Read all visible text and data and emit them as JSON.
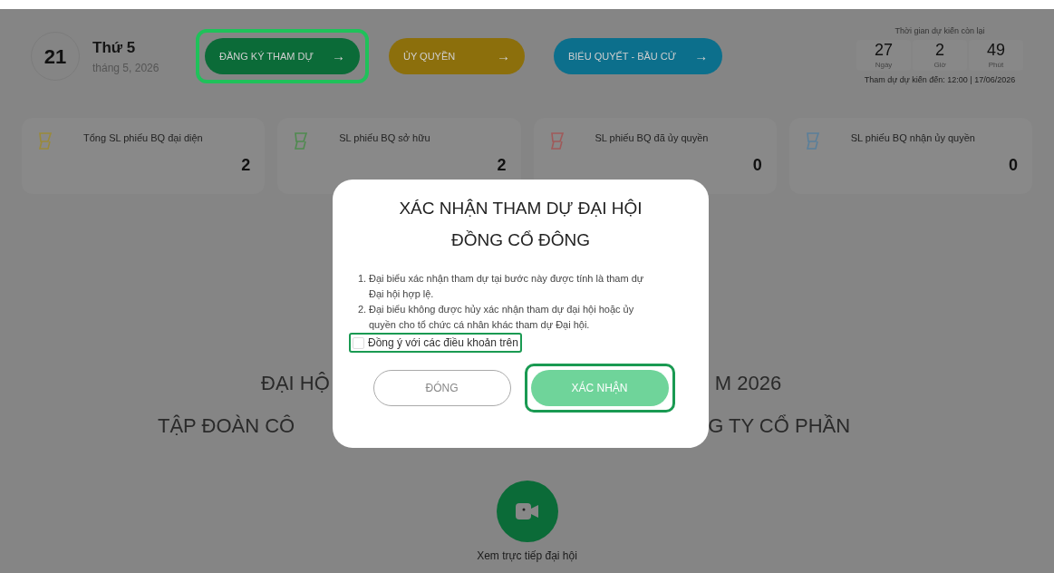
{
  "date": {
    "day": "21",
    "weekday": "Thứ 5",
    "month": "tháng 5, 2026"
  },
  "actions": [
    {
      "label": "ĐĂNG KÝ THAM DỰ",
      "arrow": "→",
      "color": "#0b6b38",
      "highlighted": true
    },
    {
      "label": "ỦY QUYỀN",
      "arrow": "→",
      "color": "#8c6f0c",
      "highlighted": false
    },
    {
      "label": "BIỂU QUYẾT - BẦU CỬ",
      "arrow": "→",
      "color": "#0c6f8c",
      "highlighted": false
    }
  ],
  "countdown": {
    "title": "Thời gian dự kiến còn lại",
    "units": [
      {
        "value": "27",
        "unit": "Ngày"
      },
      {
        "value": "2",
        "unit": "Giờ"
      },
      {
        "value": "49",
        "unit": "Phút"
      }
    ],
    "note": "Tham dự dự kiến đến: 12:00 | 17/06/2026"
  },
  "stats": [
    {
      "label": "Tổng SL phiếu BQ đại diện",
      "value": "2",
      "color": "#9a8a3a"
    },
    {
      "label": "SL phiếu BQ sở hữu",
      "value": "2",
      "color": "#4f8a4f"
    },
    {
      "label": "SL phiếu BQ đã ủy quyền",
      "value": "0",
      "color": "#a05a5a"
    },
    {
      "label": "SL phiếu BQ nhận ủy quyền",
      "value": "0",
      "color": "#5a7f9a"
    }
  ],
  "headline": {
    "line_1_left": "ĐẠI HỘ",
    "line_1_right": "M 2026",
    "line_2_left": "TẬP ĐOÀN CÔ",
    "line_2_right": "G TY CỔ PHẦN"
  },
  "live": {
    "label": "Xem trực tiếp đại hội"
  },
  "dialog": {
    "title_1": "XÁC NHẬN THAM DỰ ĐẠI HỘI",
    "title_2": "ĐỒNG CỔ ĐÔNG",
    "terms": [
      {
        "number": "1.",
        "text": "Đại biểu xác nhận tham dự tại bước này được tính là tham dự Đại hội hợp lệ."
      },
      {
        "number": "2.",
        "text": "Đại biểu không được hủy xác nhận tham dự đại hội hoặc ủy quyền cho tổ chức cá nhân khác tham dự Đại hội."
      }
    ],
    "agree": {
      "label": "Đồng ý với các điều khoản trên",
      "checked": false,
      "highlighted": true
    },
    "buttons": [
      {
        "label": "ĐÓNG",
        "kind": "outline",
        "highlighted": false
      },
      {
        "label": "XÁC NHẬN",
        "kind": "primary",
        "highlighted": true
      }
    ]
  }
}
